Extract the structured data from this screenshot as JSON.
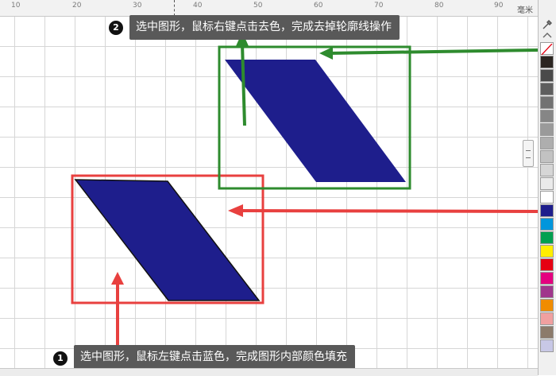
{
  "ruler": {
    "labels": [
      "10",
      "20",
      "30",
      "40",
      "50",
      "60",
      "70",
      "80",
      "90"
    ],
    "unit": "毫米"
  },
  "annotations": {
    "step1": {
      "number": "1",
      "text": "选中图形，鼠标左键点击蓝色，完成图形内部颜色填充"
    },
    "step2": {
      "number": "2",
      "text": "选中图形，鼠标右键点击去色，完成去掉轮廓线操作"
    }
  },
  "colors": {
    "shape_fill": "#1e1e8c",
    "highlight_red": "#e8403f",
    "highlight_green": "#2e8b2e",
    "palette": [
      "#2b2521",
      "#4a4a4a",
      "#5e5e5e",
      "#727272",
      "#868686",
      "#9a9a9a",
      "#aeaeae",
      "#c2c2c2",
      "#d6d6d6",
      "#eaeaea",
      "#ffffff",
      "#1e1e8c",
      "#0096dc",
      "#00a050",
      "#ffee00",
      "#e60012",
      "#e4007f",
      "#a0368c",
      "#f08c00",
      "#f0a0a0",
      "#8c7b6b",
      "#c8c8e6"
    ]
  },
  "icons": {
    "no_color": "no-color-swatch-icon",
    "eyedropper": "eyedropper-icon",
    "palette_up": "chevron-up-icon"
  }
}
